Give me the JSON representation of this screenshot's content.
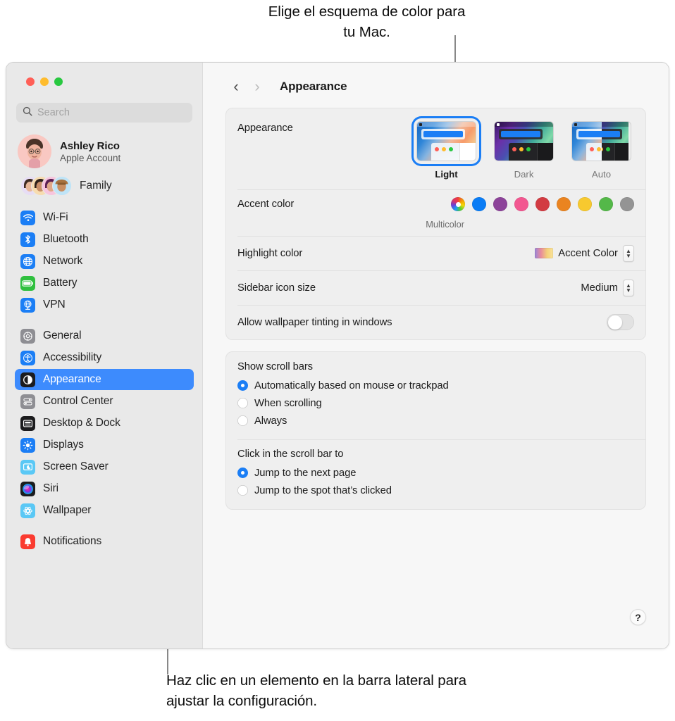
{
  "callouts": {
    "top": "Elige el esquema de color para tu Mac.",
    "bottom": "Haz clic en un elemento en la barra lateral para ajustar la configuración."
  },
  "window": {
    "traffic_lights": [
      "close",
      "minimize",
      "zoom"
    ]
  },
  "sidebar": {
    "search": {
      "placeholder": "Search",
      "value": "",
      "icon": "search-icon"
    },
    "account": {
      "name": "Ashley Rico",
      "subtitle": "Apple Account",
      "avatar": "memoji-avatar"
    },
    "family": {
      "label": "Family",
      "avatar_count": 4
    },
    "groups": [
      {
        "items": [
          {
            "label": "Wi-Fi",
            "icon": "wifi-icon",
            "color": "#1b7ef5",
            "selected": false
          },
          {
            "label": "Bluetooth",
            "icon": "bluetooth-icon",
            "color": "#1b7ef5",
            "selected": false
          },
          {
            "label": "Network",
            "icon": "globe-icon",
            "color": "#1b7ef5",
            "selected": false
          },
          {
            "label": "Battery",
            "icon": "battery-icon",
            "color": "#30c03f",
            "selected": false
          },
          {
            "label": "VPN",
            "icon": "vpn-icon",
            "color": "#1b7ef5",
            "selected": false
          }
        ]
      },
      {
        "items": [
          {
            "label": "General",
            "icon": "gear-icon",
            "color": "#8e8e93",
            "selected": false
          },
          {
            "label": "Accessibility",
            "icon": "accessibility-icon",
            "color": "#1b7ef5",
            "selected": false
          },
          {
            "label": "Appearance",
            "icon": "appearance-icon",
            "color": "#1c1c1e",
            "selected": true
          },
          {
            "label": "Control Center",
            "icon": "control-center-icon",
            "color": "#8e8e93",
            "selected": false
          },
          {
            "label": "Desktop & Dock",
            "icon": "desktop-dock-icon",
            "color": "#1c1c1e",
            "selected": false
          },
          {
            "label": "Displays",
            "icon": "displays-icon",
            "color": "#1b7ef5",
            "selected": false
          },
          {
            "label": "Screen Saver",
            "icon": "screen-saver-icon",
            "color": "#5ac8f5",
            "selected": false
          },
          {
            "label": "Siri",
            "icon": "siri-icon",
            "color": "#1c1c1e",
            "selected": false
          },
          {
            "label": "Wallpaper",
            "icon": "wallpaper-icon",
            "color": "#5ac8f5",
            "selected": false
          }
        ]
      },
      {
        "items": [
          {
            "label": "Notifications",
            "icon": "bell-icon",
            "color": "#fa3b30",
            "selected": false
          }
        ]
      }
    ]
  },
  "toolbar": {
    "back_icon": "chevron-left-icon",
    "forward_icon": "chevron-right-icon",
    "title": "Appearance"
  },
  "main": {
    "appearance": {
      "label": "Appearance",
      "themes": [
        {
          "label": "Light",
          "selected": true
        },
        {
          "label": "Dark",
          "selected": false
        },
        {
          "label": "Auto",
          "selected": false
        }
      ]
    },
    "accent_color": {
      "label": "Accent color",
      "selected_label": "Multicolor",
      "swatches": [
        {
          "name": "multicolor",
          "color": "multicolor"
        },
        {
          "name": "blue",
          "color": "#0a7cf5"
        },
        {
          "name": "purple",
          "color": "#8c4399"
        },
        {
          "name": "pink",
          "color": "#f25790"
        },
        {
          "name": "red",
          "color": "#d23b42"
        },
        {
          "name": "orange",
          "color": "#ea8420"
        },
        {
          "name": "yellow",
          "color": "#f7c92f"
        },
        {
          "name": "green",
          "color": "#54b council"
        },
        {
          "name": "graphite",
          "color": "#949494"
        }
      ]
    },
    "highlight_color": {
      "label": "Highlight color",
      "value": "Accent Color"
    },
    "sidebar_icon_size": {
      "label": "Sidebar icon size",
      "value": "Medium"
    },
    "wallpaper_tinting": {
      "label": "Allow wallpaper tinting in windows",
      "enabled": false
    },
    "show_scroll_bars": {
      "title": "Show scroll bars",
      "options": [
        {
          "label": "Automatically based on mouse or trackpad",
          "selected": true
        },
        {
          "label": "When scrolling",
          "selected": false
        },
        {
          "label": "Always",
          "selected": false
        }
      ]
    },
    "click_scroll_bar": {
      "title": "Click in the scroll bar to",
      "options": [
        {
          "label": "Jump to the next page",
          "selected": true
        },
        {
          "label": "Jump to the spot that’s clicked",
          "selected": false
        }
      ]
    },
    "help_button": {
      "label": "?"
    }
  }
}
